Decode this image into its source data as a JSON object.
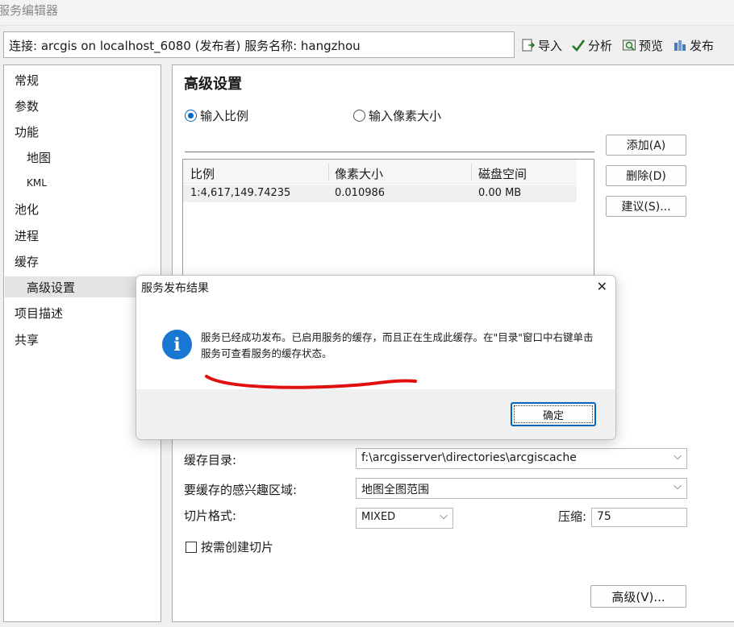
{
  "window": {
    "title": "服务编辑器"
  },
  "toolbar": {
    "connection_text": "连接: arcgis on localhost_6080 (发布者)   服务名称: hangzhou",
    "import_label": "导入",
    "analyze_label": "分析",
    "preview_label": "预览",
    "publish_label": "发布",
    "import_icon": "import-icon",
    "analyze_icon": "checkmark-icon",
    "preview_icon": "preview-icon",
    "publish_icon": "publish-icon"
  },
  "sidebar": {
    "items": [
      {
        "label": "常规"
      },
      {
        "label": "参数"
      },
      {
        "label": "功能"
      },
      {
        "label": "地图"
      },
      {
        "label": "KML"
      },
      {
        "label": "池化"
      },
      {
        "label": "进程"
      },
      {
        "label": "缓存"
      },
      {
        "label": "高级设置"
      },
      {
        "label": "项目描述"
      },
      {
        "label": "共享"
      }
    ],
    "selected": "高级设置"
  },
  "main": {
    "heading": "高级设置",
    "radio_scale": "输入比例",
    "radio_pixel": "输入像素大小",
    "table": {
      "columns": [
        "比例",
        "像素大小",
        "磁盘空间"
      ],
      "rows": [
        [
          "1:4,617,149.74235",
          "0.010986",
          "0.00 MB"
        ]
      ]
    },
    "buttons": {
      "add": "添加(A)",
      "delete": "删除(D)",
      "suggest": "建议(S)...",
      "advanced": "高级(V)..."
    },
    "cache_dir_label": "缓存目录:",
    "cache_dir_value": "f:\\arcgisserver\\directories\\arcgiscache",
    "aoi_label": "要缓存的感兴趣区域:",
    "aoi_value": "地图全图范围",
    "tile_format_label": "切片格式:",
    "tile_format_value": "MIXED",
    "compression_label": "压缩:",
    "compression_value": "75",
    "create_on_demand_label": "按需创建切片",
    "create_on_demand_checked": false
  },
  "dialog": {
    "title": "服务发布结果",
    "message": "服务已经成功发布。已启用服务的缓存，而且正在生成此缓存。在\"目录\"窗口中右键单击服务可查看服务的缓存状态。",
    "ok_label": "确定",
    "icon": "info-icon",
    "annotation_color": "#e01010"
  },
  "colors": {
    "accent": "#0067c0",
    "info_icon": "#1976d2"
  }
}
